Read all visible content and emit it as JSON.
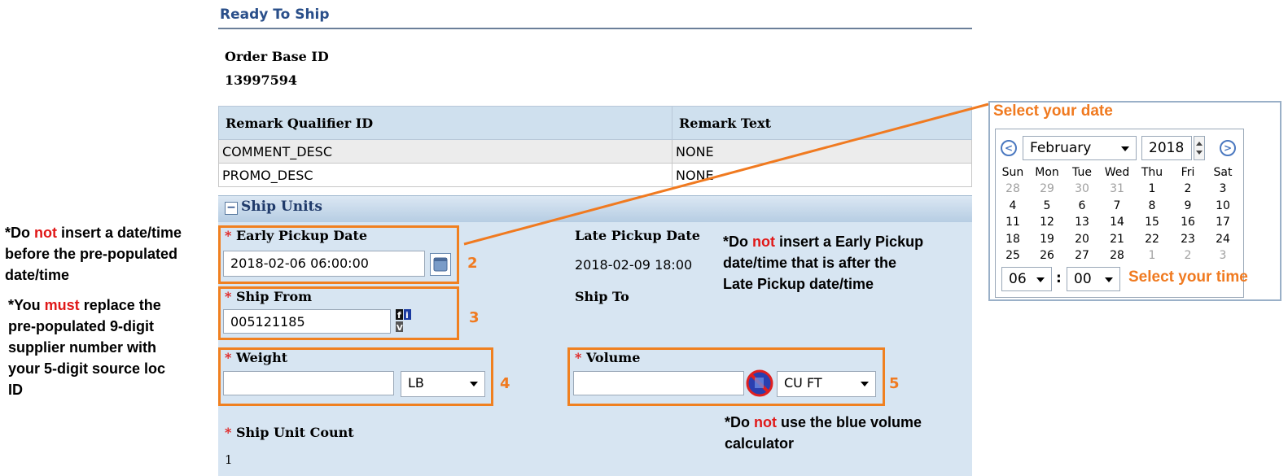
{
  "page": {
    "title": "Ready To Ship",
    "order_base_label": "Order Base ID",
    "order_base_value": "13997594"
  },
  "remarks": {
    "headers": [
      "Remark Qualifier ID",
      "Remark Text"
    ],
    "rows": [
      [
        "COMMENT_DESC",
        "NONE"
      ],
      [
        "PROMO_DESC",
        "NONE"
      ]
    ]
  },
  "ship_units": {
    "title": "Ship Units",
    "collapse_symbol": "−",
    "early_pickup_label": "Early Pickup Date",
    "early_pickup_value": "2018-02-06 06:00:00",
    "late_pickup_label": "Late Pickup Date",
    "late_pickup_value": "2018-02-09 18:00",
    "ship_from_label": "Ship From",
    "ship_from_value": "005121185",
    "ship_to_label": "Ship To",
    "weight_label": "Weight",
    "weight_value": "",
    "weight_unit": "LB",
    "volume_label": "Volume",
    "volume_value": "",
    "volume_unit": "CU FT",
    "ship_unit_count_label": "Ship Unit Count",
    "ship_unit_count_value": "1",
    "required_mark": "*"
  },
  "callout_numbers": [
    "2",
    "3",
    "4",
    "5"
  ],
  "notes": {
    "early_prefix": "*Do ",
    "early_red": "not",
    "early_suffix": " insert a Early Pickup",
    "early_line2": "date/time that is after the",
    "early_line3": "Late Pickup date/time",
    "left1_prefix": "*Do ",
    "left1_red": "not",
    "left1_suffix": " insert a date/time",
    "left1_line2": "before the pre-populated",
    "left1_line3": "date/time",
    "left2_prefix": "*You ",
    "left2_red": "must",
    "left2_suffix": " replace the",
    "left2_line2": "pre-populated 9-digit",
    "left2_line3": "supplier number with",
    "left2_line4": "your 5-digit source loc",
    "left2_line5": "ID",
    "vol_prefix": "*Do ",
    "vol_red": "not",
    "vol_suffix": " use the blue volume",
    "vol_line2": "calculator"
  },
  "calendar": {
    "title": "Select your date",
    "month": "February",
    "year": "2018",
    "weekdays": [
      "Sun",
      "Mon",
      "Tue",
      "Wed",
      "Thu",
      "Fri",
      "Sat"
    ],
    "weeks": [
      [
        "28",
        "29",
        "30",
        "31",
        "1",
        "2",
        "3"
      ],
      [
        "4",
        "5",
        "6",
        "7",
        "8",
        "9",
        "10"
      ],
      [
        "11",
        "12",
        "13",
        "14",
        "15",
        "16",
        "17"
      ],
      [
        "18",
        "19",
        "20",
        "21",
        "22",
        "23",
        "24"
      ],
      [
        "25",
        "26",
        "27",
        "28",
        "1",
        "2",
        "3"
      ]
    ],
    "hour": "06",
    "minute": "00",
    "time_separator": ":",
    "time_note": "Select your time",
    "prev_symbol": "<",
    "next_symbol": ">"
  },
  "icons": {
    "calendar_button": "calendar-icon",
    "ship_from_lookup": "lookup-icon",
    "volume_calculator": "volume-calculator-icon"
  },
  "colors": {
    "accent_orange": "#f07a20",
    "required_red": "#e02020",
    "panel_blue": "#d7e5f2",
    "header_blue": "#2a4f8a"
  }
}
